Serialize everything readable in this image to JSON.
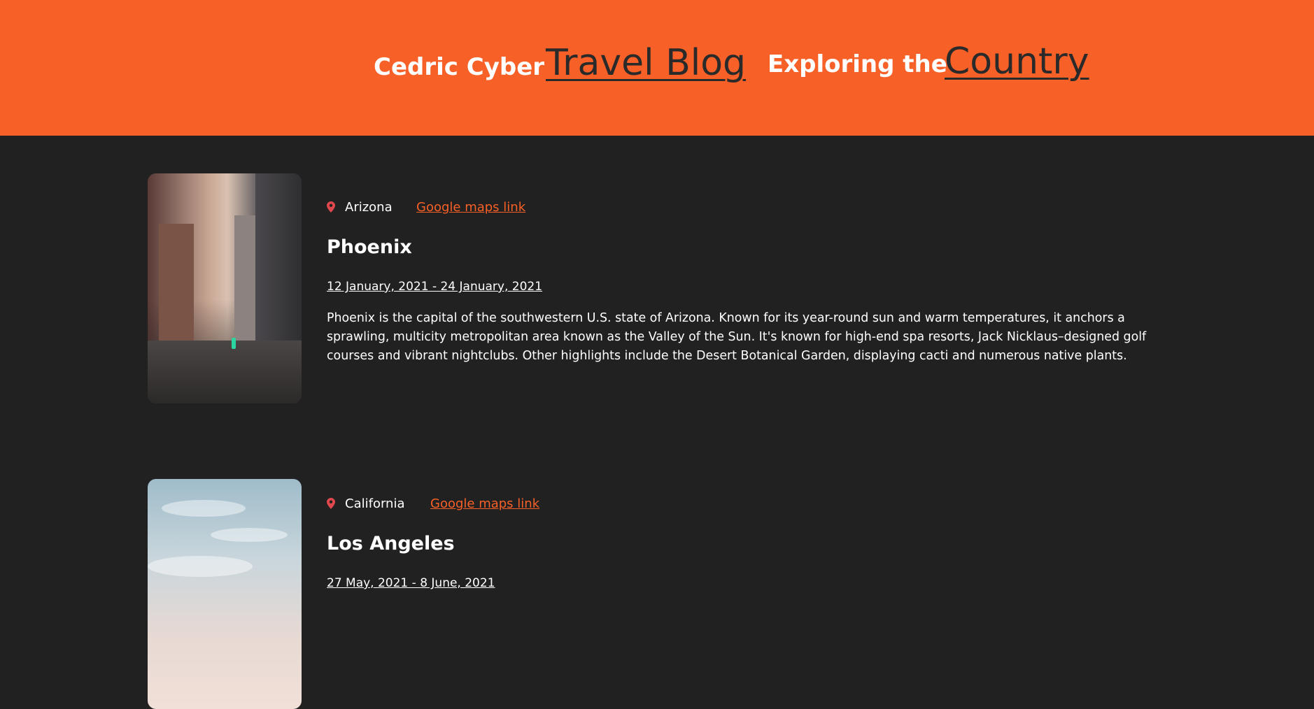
{
  "header": {
    "name": "Cedric Cyber",
    "blog_link": "Travel Blog",
    "exploring": "Exploring the",
    "country_link": "Country",
    "background_color": "#f76027"
  },
  "entries": [
    {
      "image_icon": "city-street-photo",
      "pin_icon": "map-pin-icon",
      "state": "Arizona",
      "maps_link": "Google maps link",
      "city": "Phoenix",
      "dates": "12 January, 2021 - 24 January, 2021",
      "description": "Phoenix is the capital of the southwestern U.S. state of Arizona. Known for its year-round sun and warm temperatures, it anchors a sprawling, multicity metropolitan area known as the Valley of the Sun. It's known for high-end spa resorts, Jack Nicklaus–designed golf courses and vibrant nightclubs. Other highlights include the Desert Botanical Garden, displaying cacti and numerous native plants."
    },
    {
      "image_icon": "cloudy-sky-photo",
      "pin_icon": "map-pin-icon",
      "state": "California",
      "maps_link": "Google maps link",
      "city": "Los Angeles",
      "dates": "27 May, 2021 - 8 June, 2021"
    }
  ],
  "colors": {
    "accent": "#f76027",
    "page_background": "#212121",
    "pin": "#e0484d"
  }
}
